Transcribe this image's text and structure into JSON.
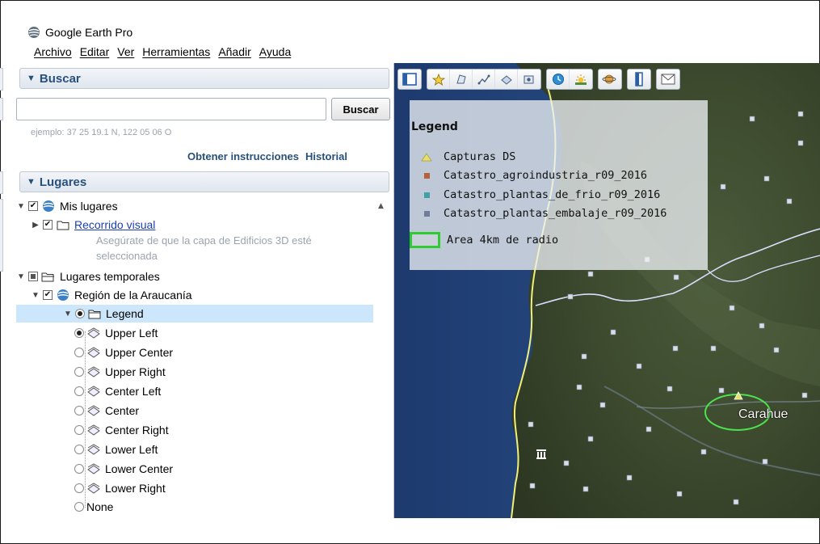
{
  "window": {
    "title": "Google Earth Pro",
    "menu": [
      "Archivo",
      "Editar",
      "Ver",
      "Herramientas",
      "Añadir",
      "Ayuda"
    ]
  },
  "search_panel": {
    "header": "Buscar",
    "input_value": "",
    "button_label": "Buscar",
    "example_text": "ejemplo: 37 25 19.1 N, 122 05 06 O",
    "directions_link": "Obtener instrucciones",
    "history_link": "Historial"
  },
  "places_panel": {
    "header": "Lugares",
    "my_places": "Mis lugares",
    "tour_link": "Recorrido visual",
    "tour_note_line1": "Asegúrate de que la capa de Edificios 3D esté",
    "tour_note_line2": "seleccionada",
    "temp_places": "Lugares temporales",
    "region": "Región de la Araucanía",
    "legend_folder": "Legend",
    "options": [
      {
        "label": "Upper Left",
        "selected": true
      },
      {
        "label": "Upper Center",
        "selected": false
      },
      {
        "label": "Upper Right",
        "selected": false
      },
      {
        "label": "Center Left",
        "selected": false
      },
      {
        "label": "Center",
        "selected": false
      },
      {
        "label": "Center Right",
        "selected": false
      },
      {
        "label": "Lower Left",
        "selected": false
      },
      {
        "label": "Lower Center",
        "selected": false
      },
      {
        "label": "Lower Right",
        "selected": false
      },
      {
        "label": "None",
        "selected": false
      }
    ]
  },
  "map_legend": {
    "title": "Legend",
    "items": [
      {
        "label": "Capturas DS",
        "color": "#e8e06a",
        "shape": "triangle"
      },
      {
        "label": "Catastro_agroindustria_r09_2016",
        "color": "#b5613f",
        "shape": "square"
      },
      {
        "label": "Catastro_plantas_de_frio_r09_2016",
        "color": "#3fa0a6",
        "shape": "square"
      },
      {
        "label": "Catastro_plantas_embalaje_r09_2016",
        "color": "#6f7d9b",
        "shape": "square"
      },
      {
        "label": "Area 4km de radio",
        "color": "#2fcc2f",
        "shape": "outline"
      }
    ]
  },
  "map_labels": {
    "town": "Carahue"
  },
  "colors": {
    "panel_header_text": "#27507a",
    "selection": "#cce6fb",
    "coast_line": "#f0f07a",
    "border_line": "#d8e0ff",
    "radius_circle": "#4fe04f"
  }
}
